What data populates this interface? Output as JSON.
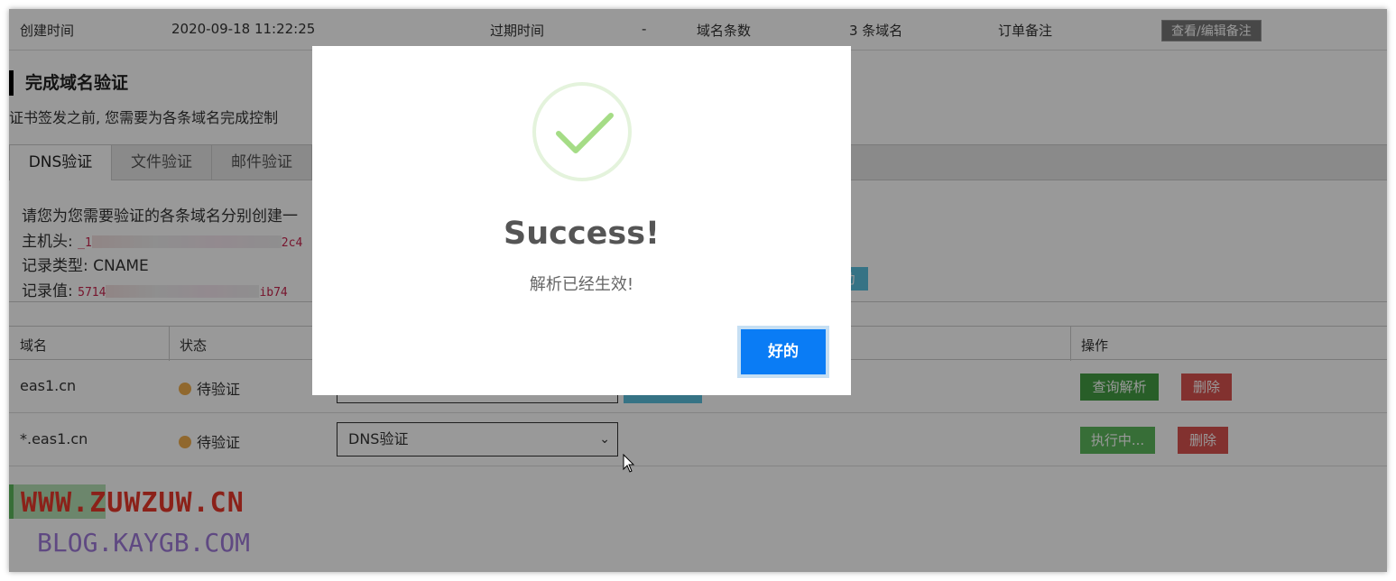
{
  "info": {
    "created_label": "创建时间",
    "created_value": "2020-09-18 11:22:25",
    "expire_label": "过期时间",
    "expire_value": "-",
    "domain_count_label": "域名条数",
    "domain_count_value": "3 条域名",
    "note_label": "订单备注",
    "note_button": "查看/编辑备注"
  },
  "section": {
    "title": "完成域名验证",
    "description": "证书签发之前, 您需要为各条域名完成控制"
  },
  "tabs": [
    {
      "label": "DNS验证"
    },
    {
      "label": "文件验证"
    },
    {
      "label": "邮件验证"
    }
  ],
  "dns": {
    "intro": "请您为您需要验证的各条域名分别创建一",
    "host_label": "主机头:",
    "host_value_start": "_1",
    "host_value_end": "2c4",
    "type_label": "记录类型:",
    "type_value": "CNAME",
    "record_label": "记录值:",
    "record_value_start": "5714",
    "record_value_end": "ib74",
    "verify_button_tail": "动"
  },
  "table": {
    "headers": [
      "域名",
      "状态",
      "操作"
    ],
    "rows": [
      {
        "domain": "eas1.cn",
        "status": "待验证",
        "method": "",
        "btn1": "查询解析",
        "btn2": "删除"
      },
      {
        "domain": "*.eas1.cn",
        "status": "待验证",
        "method": "DNS验证",
        "btn1": "执行中...",
        "btn2": "删除"
      }
    ]
  },
  "watermark": {
    "line1": "WWW.ZUWZUW.CN",
    "line2": "BLOG.KAYGB.COM"
  },
  "modal": {
    "title": "Success!",
    "message": "解析已经生效!",
    "ok_button": "好的",
    "icon": "check-icon"
  },
  "colors": {
    "primary": "#0a7cf5",
    "success": "#5cb85c",
    "danger": "#d9534f",
    "info": "#5bc0de",
    "pending": "#f0ad4e"
  }
}
